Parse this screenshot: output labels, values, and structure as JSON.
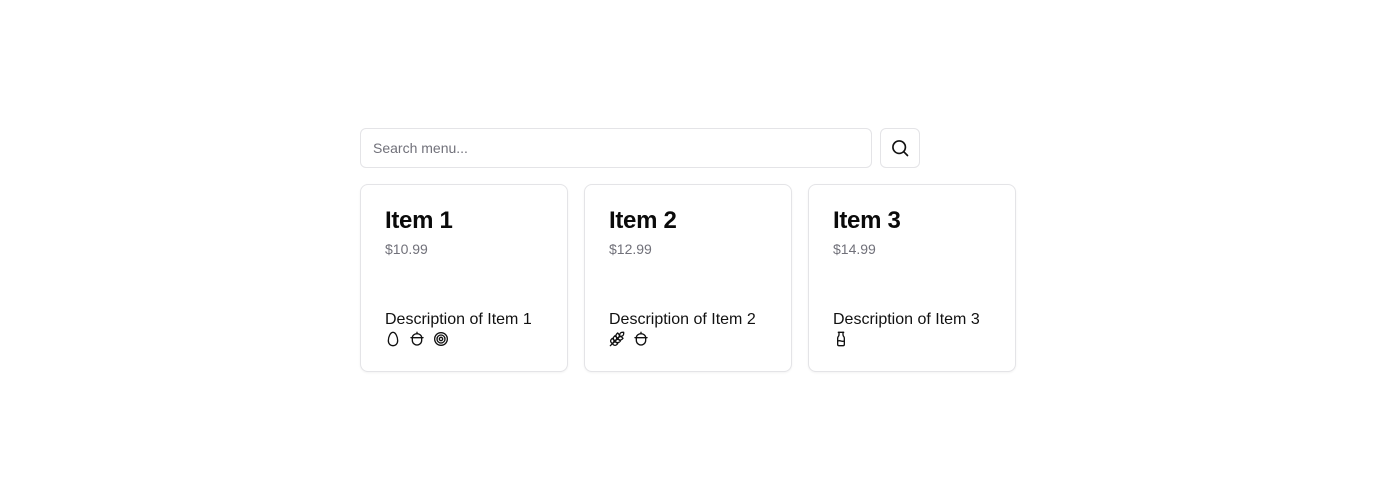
{
  "search": {
    "placeholder": "Search menu...",
    "button_icon": "search-icon"
  },
  "items": [
    {
      "name": "Item 1",
      "price": "$10.99",
      "description": "Description of Item 1",
      "icons": [
        "egg-icon",
        "nut-icon",
        "shell-icon"
      ]
    },
    {
      "name": "Item 2",
      "price": "$12.99",
      "description": "Description of Item 2",
      "icons": [
        "wheat-icon",
        "nut-icon"
      ]
    },
    {
      "name": "Item 3",
      "price": "$14.99",
      "description": "Description of Item 3",
      "icons": [
        "milk-icon"
      ]
    }
  ]
}
